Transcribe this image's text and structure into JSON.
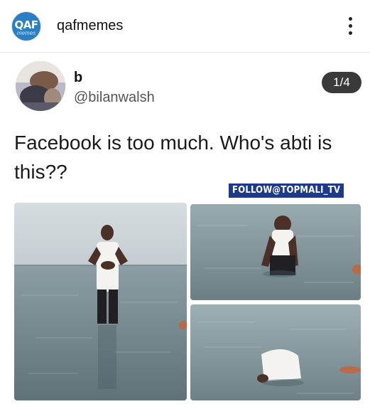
{
  "instagram_post": {
    "avatar_logo_text": "QAF",
    "avatar_logo_sub": "memes",
    "username": "qafmemes"
  },
  "tweet": {
    "display_name": "b",
    "handle": "@bilanwalsh",
    "media_counter": "1/4",
    "text": "Facebook is too much. Who's abti is this??"
  },
  "media": {
    "watermark": "FOLLOW@TOPMALI_TV"
  },
  "colors": {
    "badge_bg": "#3a3a3a",
    "watermark_bg": "#1d3a8a",
    "sea": "#6f8b92",
    "sky": "#c9d3d8"
  },
  "icons": {
    "more": "more-vertical-icon"
  }
}
